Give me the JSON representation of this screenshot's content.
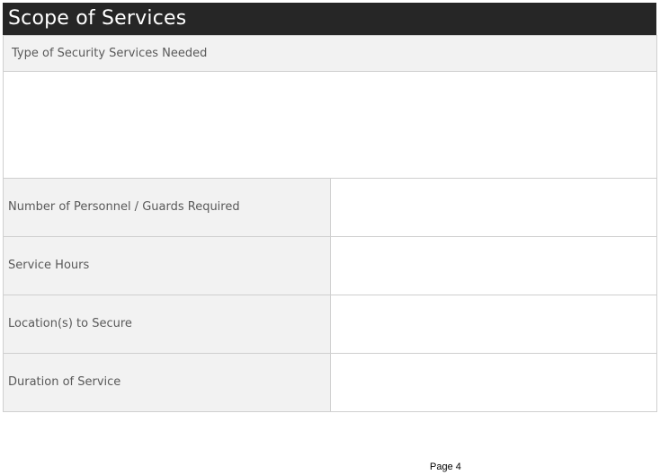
{
  "document": {
    "title": "Scope of Services",
    "section_label": "Type of Security Services Needed",
    "rows": [
      {
        "label": "Number of Personnel / Guards Required",
        "value": ""
      },
      {
        "label": "Service Hours",
        "value": ""
      },
      {
        "label": "Location(s) to Secure",
        "value": ""
      },
      {
        "label": "Duration of Service",
        "value": ""
      }
    ],
    "footer": {
      "page_label": "Page 4"
    }
  },
  "colors": {
    "title_bar": "#262626",
    "label_background": "#f2f2f2",
    "border": "#cfcfcf",
    "label_text": "#595959"
  }
}
